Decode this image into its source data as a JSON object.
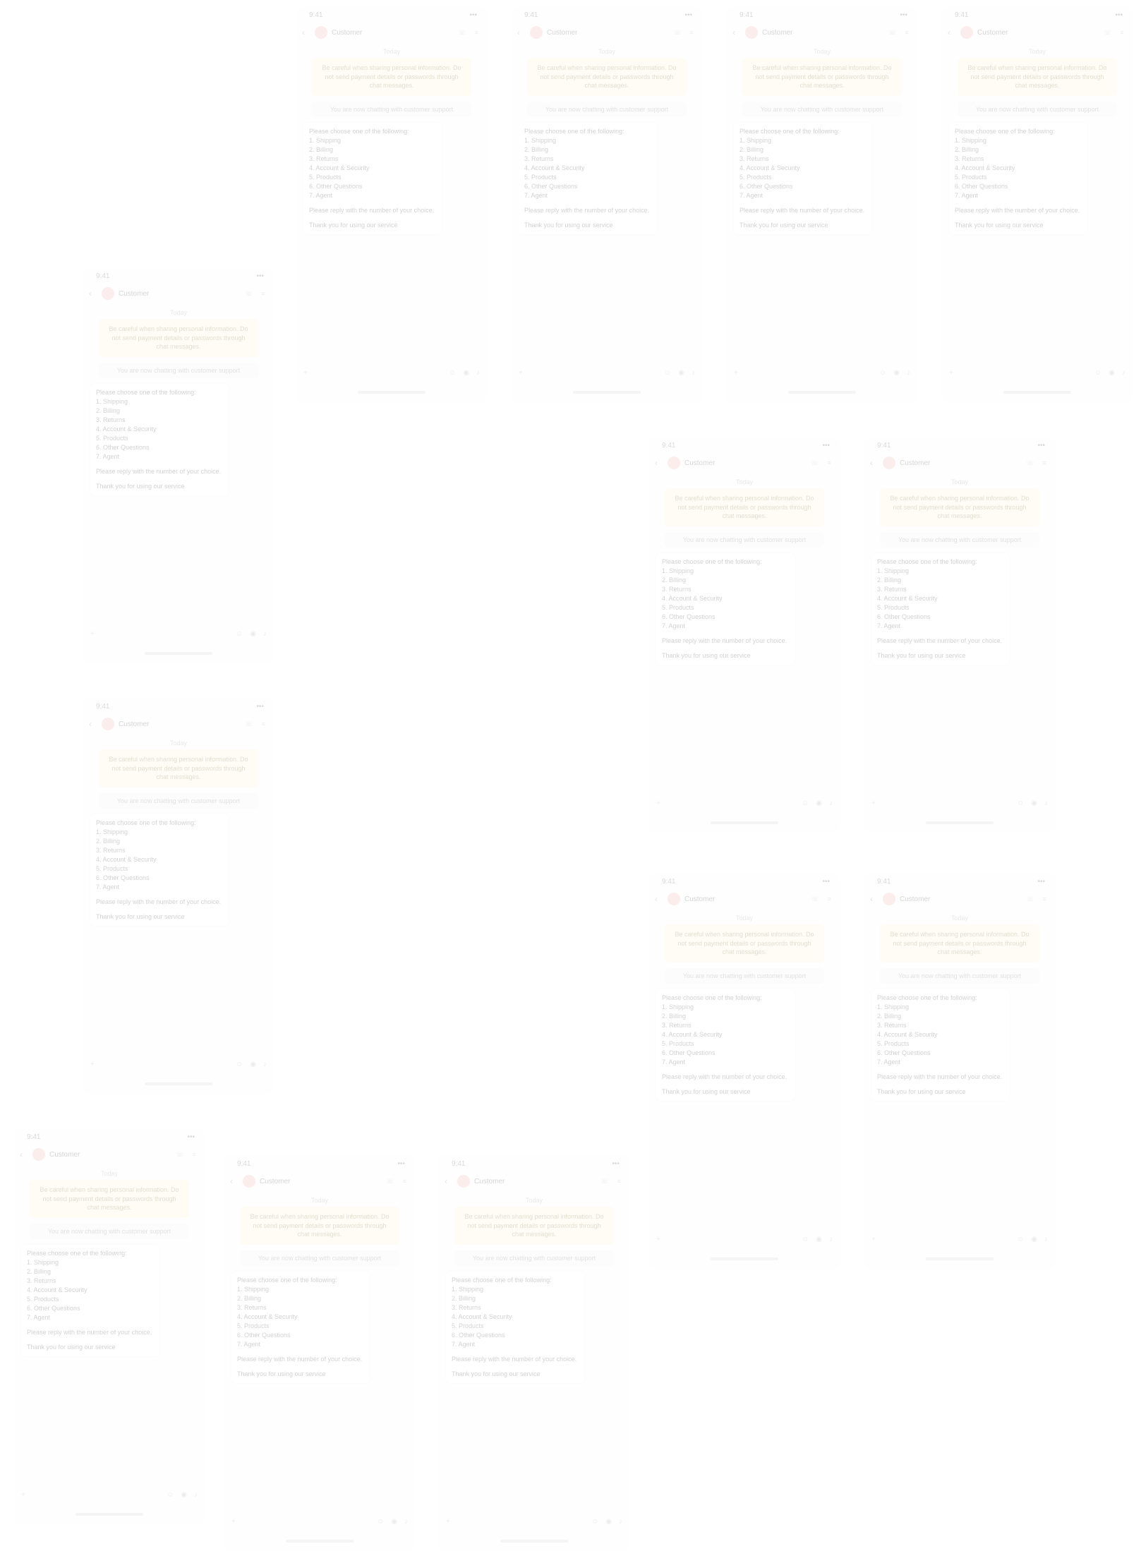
{
  "screen": {
    "time": "9:41",
    "status_right": "•••",
    "contact_name": "Customer",
    "date_label": "Today",
    "warning": "Be careful when sharing personal information. Do not send payment details or passwords through chat messages.",
    "system_note": "You are now chatting with customer support",
    "message_intro": "Please choose one of the following:",
    "options": [
      "1. Shipping",
      "2. Billing",
      "3. Returns",
      "4. Account & Security",
      "5. Products",
      "6. Other Questions",
      "7. Agent"
    ],
    "followup": "Please reply with the number of your choice.",
    "footer_text": "Thank you for using our service",
    "input_plus": "+",
    "icons": [
      "sticker-icon",
      "camera-icon",
      "mic-icon"
    ]
  },
  "phones": [
    {
      "id": 1
    },
    {
      "id": 2
    },
    {
      "id": 3
    },
    {
      "id": 4
    },
    {
      "id": 5
    },
    {
      "id": 6
    },
    {
      "id": 7
    },
    {
      "id": 8
    },
    {
      "id": 9
    },
    {
      "id": 10
    },
    {
      "id": 11
    },
    {
      "id": 12
    },
    {
      "id": 13
    }
  ]
}
